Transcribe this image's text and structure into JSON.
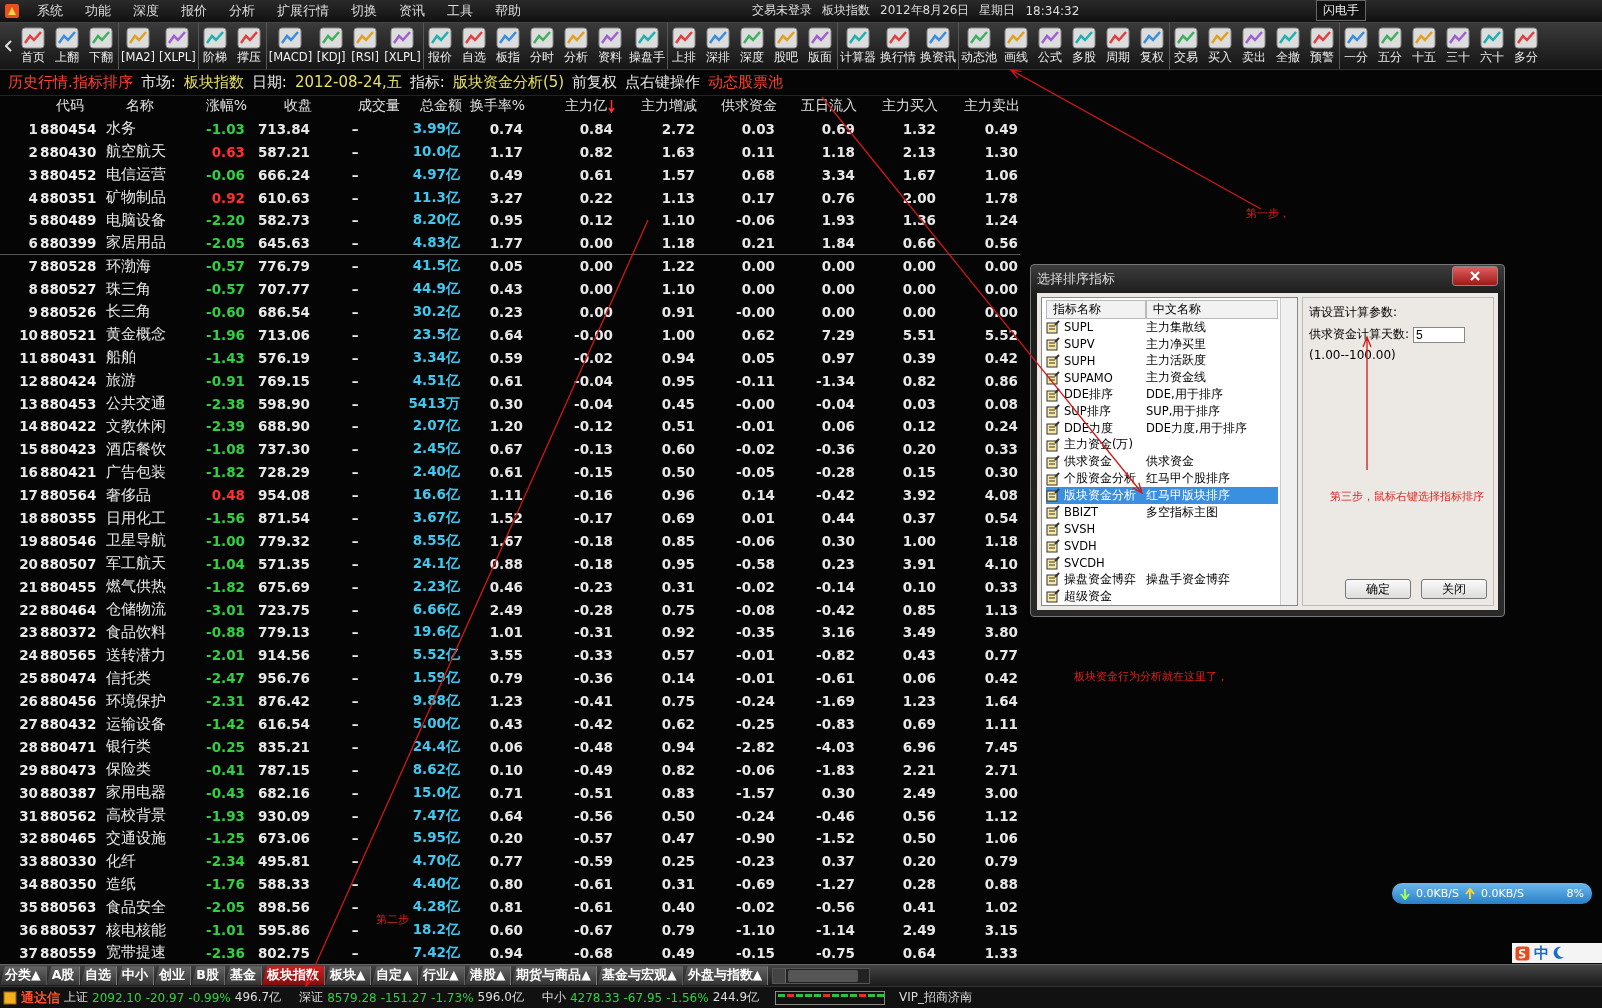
{
  "menu_bar": {
    "items": [
      "系统",
      "功能",
      "深度",
      "报价",
      "分析",
      "扩展行情",
      "切换",
      "资讯",
      "工具",
      "帮助"
    ],
    "status": [
      "交易未登录",
      "板块指数",
      "2012年8月26日",
      "星期日",
      "18:34:32"
    ],
    "flash_button": "闪电手"
  },
  "toolbar": {
    "items": [
      {
        "label": "首页"
      },
      {
        "label": "上翻"
      },
      {
        "label": "下翻"
      },
      {
        "label": "[MA2]",
        "sep_before": true
      },
      {
        "label": "[XLPL]"
      },
      {
        "label": "阶梯",
        "sep_before": true
      },
      {
        "label": "撑压"
      },
      {
        "label": "[MACD]",
        "sep_before": true
      },
      {
        "label": "[KDJ]"
      },
      {
        "label": "[RSI]"
      },
      {
        "label": "[XLPL]"
      },
      {
        "label": "报价",
        "sep_before": true
      },
      {
        "label": "自选"
      },
      {
        "label": "板指"
      },
      {
        "label": "分时"
      },
      {
        "label": "分析"
      },
      {
        "label": "资料"
      },
      {
        "label": "操盘手"
      },
      {
        "label": "上排",
        "sep_before": true
      },
      {
        "label": "深排"
      },
      {
        "label": "深度"
      },
      {
        "label": "股吧"
      },
      {
        "label": "版面"
      },
      {
        "label": "计算器",
        "sep_before": true
      },
      {
        "label": "换行情"
      },
      {
        "label": "换资讯"
      },
      {
        "label": "动态池",
        "sep_before": true
      },
      {
        "label": "画线"
      },
      {
        "label": "公式"
      },
      {
        "label": "多股"
      },
      {
        "label": "周期"
      },
      {
        "label": "复权"
      },
      {
        "label": "交易",
        "sep_before": true
      },
      {
        "label": "买入"
      },
      {
        "label": "卖出"
      },
      {
        "label": "全撤"
      },
      {
        "label": "预警"
      },
      {
        "label": "一分",
        "sep_before": true
      },
      {
        "label": "五分"
      },
      {
        "label": "十五"
      },
      {
        "label": "三十"
      },
      {
        "label": "六十"
      },
      {
        "label": "多分"
      }
    ]
  },
  "info_line": [
    {
      "text": "历史行情.指标排序",
      "color": "#ff4030"
    },
    {
      "text": "市场:",
      "color": "#e8e8e8"
    },
    {
      "text": "板块指数",
      "color": "#e8e060"
    },
    {
      "text": "日期:",
      "color": "#e8e8e8"
    },
    {
      "text": "2012-08-24,五",
      "color": "#e8e060"
    },
    {
      "text": "指标:",
      "color": "#e8e8e8"
    },
    {
      "text": "版块资金分析(5)",
      "color": "#e8e060"
    },
    {
      "text": "前复权",
      "color": "#e8e8e8"
    },
    {
      "text": "点右键操作",
      "color": "#e8e8e8"
    },
    {
      "text": "动态股票池",
      "color": "#ff4030"
    }
  ],
  "table": {
    "columns": [
      {
        "label": "代码",
        "sorted": false
      },
      {
        "label": "名称",
        "sorted": false
      },
      {
        "label": "涨幅%",
        "sorted": false
      },
      {
        "label": "收盘",
        "sorted": false
      },
      {
        "label": "成交量",
        "sorted": false
      },
      {
        "label": "总金额",
        "sorted": false
      },
      {
        "label": "换手率%",
        "sorted": false
      },
      {
        "label": "主力亿",
        "sorted": true
      },
      {
        "label": "主力增减",
        "sorted": false
      },
      {
        "label": "供求资金",
        "sorted": false
      },
      {
        "label": "五日流入",
        "sorted": false
      },
      {
        "label": "主力买入",
        "sorted": false
      },
      {
        "label": "主力卖出",
        "sorted": false
      }
    ],
    "rows": [
      {
        "no": "1",
        "rising": false,
        "cells": [
          "880454",
          "水务",
          "-1.03",
          "713.84",
          "–",
          "3.99亿",
          "0.74",
          "0.84",
          "2.72",
          "0.03",
          "0.69",
          "1.32",
          "0.49"
        ]
      },
      {
        "no": "2",
        "rising": true,
        "cells": [
          "880430",
          "航空航天",
          "0.63",
          "587.21",
          "–",
          "10.0亿",
          "1.17",
          "0.82",
          "1.63",
          "0.11",
          "1.18",
          "2.13",
          "1.30"
        ]
      },
      {
        "no": "3",
        "rising": false,
        "cells": [
          "880452",
          "电信运营",
          "-0.06",
          "666.24",
          "–",
          "4.97亿",
          "0.49",
          "0.61",
          "1.57",
          "0.68",
          "3.34",
          "1.67",
          "1.06"
        ]
      },
      {
        "no": "4",
        "rising": true,
        "cells": [
          "880351",
          "矿物制品",
          "0.92",
          "610.63",
          "–",
          "11.3亿",
          "3.27",
          "0.22",
          "1.13",
          "0.17",
          "0.76",
          "2.00",
          "1.78"
        ]
      },
      {
        "no": "5",
        "rising": false,
        "cells": [
          "880489",
          "电脑设备",
          "-2.20",
          "582.73",
          "–",
          "8.20亿",
          "0.95",
          "0.12",
          "1.10",
          "-0.06",
          "1.93",
          "1.36",
          "1.24"
        ]
      },
      {
        "no": "6",
        "rising": false,
        "divider_after": true,
        "cells": [
          "880399",
          "家居用品",
          "-2.05",
          "645.63",
          "–",
          "4.83亿",
          "1.77",
          "0.00",
          "1.18",
          "0.21",
          "1.84",
          "0.66",
          "0.56"
        ]
      },
      {
        "no": "7",
        "rising": false,
        "cells": [
          "880528",
          "环渤海",
          "-0.57",
          "776.79",
          "–",
          "41.5亿",
          "0.05",
          "0.00",
          "1.22",
          "0.00",
          "0.00",
          "0.00",
          "0.00"
        ]
      },
      {
        "no": "8",
        "rising": false,
        "cells": [
          "880527",
          "珠三角",
          "-0.57",
          "707.77",
          "–",
          "44.9亿",
          "0.43",
          "0.00",
          "1.10",
          "0.00",
          "0.00",
          "0.00",
          "0.00"
        ]
      },
      {
        "no": "9",
        "rising": false,
        "cells": [
          "880526",
          "长三角",
          "-0.60",
          "686.54",
          "–",
          "30.2亿",
          "0.23",
          "0.00",
          "0.91",
          "-0.00",
          "0.00",
          "0.00",
          "0.00"
        ]
      },
      {
        "no": "10",
        "rising": false,
        "cells": [
          "880521",
          "黄金概念",
          "-1.96",
          "713.06",
          "–",
          "23.5亿",
          "0.64",
          "-0.00",
          "1.00",
          "0.62",
          "7.29",
          "5.51",
          "5.52"
        ]
      },
      {
        "no": "11",
        "rising": false,
        "cells": [
          "880431",
          "船舶",
          "-1.43",
          "576.19",
          "–",
          "3.34亿",
          "0.59",
          "-0.02",
          "0.94",
          "0.05",
          "0.97",
          "0.39",
          "0.42"
        ]
      },
      {
        "no": "12",
        "rising": false,
        "cells": [
          "880424",
          "旅游",
          "-0.91",
          "769.15",
          "–",
          "4.51亿",
          "0.61",
          "-0.04",
          "0.95",
          "-0.11",
          "-1.34",
          "0.82",
          "0.86"
        ]
      },
      {
        "no": "13",
        "rising": false,
        "cells": [
          "880453",
          "公共交通",
          "-2.38",
          "598.90",
          "–",
          "5413万",
          "0.30",
          "-0.04",
          "0.45",
          "-0.00",
          "-0.04",
          "0.03",
          "0.08"
        ]
      },
      {
        "no": "14",
        "rising": false,
        "cells": [
          "880422",
          "文教休闲",
          "-2.39",
          "688.90",
          "–",
          "2.07亿",
          "1.20",
          "-0.12",
          "0.51",
          "-0.01",
          "0.06",
          "0.12",
          "0.24"
        ]
      },
      {
        "no": "15",
        "rising": false,
        "cells": [
          "880423",
          "酒店餐饮",
          "-1.08",
          "737.30",
          "–",
          "2.45亿",
          "0.67",
          "-0.13",
          "0.60",
          "-0.02",
          "-0.36",
          "0.20",
          "0.33"
        ]
      },
      {
        "no": "16",
        "rising": false,
        "cells": [
          "880421",
          "广告包装",
          "-1.82",
          "728.29",
          "–",
          "2.40亿",
          "0.61",
          "-0.15",
          "0.50",
          "-0.05",
          "-0.28",
          "0.15",
          "0.30"
        ]
      },
      {
        "no": "17",
        "rising": true,
        "cells": [
          "880564",
          "奢侈品",
          "0.48",
          "954.08",
          "–",
          "16.6亿",
          "1.11",
          "-0.16",
          "0.96",
          "0.14",
          "-0.42",
          "3.92",
          "4.08"
        ]
      },
      {
        "no": "18",
        "rising": false,
        "cells": [
          "880355",
          "日用化工",
          "-1.56",
          "871.54",
          "–",
          "3.67亿",
          "1.52",
          "-0.17",
          "0.69",
          "0.01",
          "0.44",
          "0.37",
          "0.54"
        ]
      },
      {
        "no": "19",
        "rising": false,
        "cells": [
          "880546",
          "卫星导航",
          "-1.00",
          "779.32",
          "–",
          "8.55亿",
          "1.67",
          "-0.18",
          "0.85",
          "-0.06",
          "0.30",
          "1.00",
          "1.18"
        ]
      },
      {
        "no": "20",
        "rising": false,
        "cells": [
          "880507",
          "军工航天",
          "-1.04",
          "571.35",
          "–",
          "24.1亿",
          "0.88",
          "-0.18",
          "0.95",
          "-0.58",
          "0.23",
          "3.91",
          "4.10"
        ]
      },
      {
        "no": "21",
        "rising": false,
        "cells": [
          "880455",
          "燃气供热",
          "-1.82",
          "675.69",
          "–",
          "2.23亿",
          "0.46",
          "-0.23",
          "0.31",
          "-0.02",
          "-0.14",
          "0.10",
          "0.33"
        ]
      },
      {
        "no": "22",
        "rising": false,
        "cells": [
          "880464",
          "仓储物流",
          "-3.01",
          "723.75",
          "–",
          "6.66亿",
          "2.49",
          "-0.28",
          "0.75",
          "-0.08",
          "-0.42",
          "0.85",
          "1.13"
        ]
      },
      {
        "no": "23",
        "rising": false,
        "cells": [
          "880372",
          "食品饮料",
          "-0.88",
          "779.13",
          "–",
          "19.6亿",
          "1.01",
          "-0.31",
          "0.92",
          "-0.35",
          "3.16",
          "3.49",
          "3.80"
        ]
      },
      {
        "no": "24",
        "rising": false,
        "cells": [
          "880565",
          "送转潜力",
          "-2.01",
          "914.56",
          "–",
          "5.52亿",
          "3.55",
          "-0.33",
          "0.57",
          "-0.01",
          "-0.82",
          "0.43",
          "0.77"
        ]
      },
      {
        "no": "25",
        "rising": false,
        "cells": [
          "880474",
          "信托类",
          "-2.47",
          "956.76",
          "–",
          "1.59亿",
          "0.79",
          "-0.36",
          "0.14",
          "-0.01",
          "-0.61",
          "0.06",
          "0.42"
        ]
      },
      {
        "no": "26",
        "rising": false,
        "cells": [
          "880456",
          "环境保护",
          "-2.31",
          "876.42",
          "–",
          "9.88亿",
          "1.23",
          "-0.41",
          "0.75",
          "-0.24",
          "-1.69",
          "1.23",
          "1.64"
        ]
      },
      {
        "no": "27",
        "rising": false,
        "cells": [
          "880432",
          "运输设备",
          "-1.42",
          "616.54",
          "–",
          "5.00亿",
          "0.43",
          "-0.42",
          "0.62",
          "-0.25",
          "-0.83",
          "0.69",
          "1.11"
        ]
      },
      {
        "no": "28",
        "rising": false,
        "cells": [
          "880471",
          "银行类",
          "-0.25",
          "835.21",
          "–",
          "24.4亿",
          "0.06",
          "-0.48",
          "0.94",
          "-2.82",
          "-4.03",
          "6.96",
          "7.45"
        ]
      },
      {
        "no": "29",
        "rising": false,
        "cells": [
          "880473",
          "保险类",
          "-0.41",
          "787.15",
          "–",
          "8.62亿",
          "0.10",
          "-0.49",
          "0.82",
          "-0.06",
          "-1.83",
          "2.21",
          "2.71"
        ]
      },
      {
        "no": "30",
        "rising": false,
        "cells": [
          "880387",
          "家用电器",
          "-0.43",
          "682.16",
          "–",
          "15.0亿",
          "0.71",
          "-0.51",
          "0.83",
          "-1.57",
          "0.30",
          "2.49",
          "3.00"
        ]
      },
      {
        "no": "31",
        "rising": false,
        "cells": [
          "880562",
          "高校背景",
          "-1.93",
          "930.09",
          "–",
          "7.47亿",
          "0.64",
          "-0.56",
          "0.50",
          "-0.24",
          "-0.46",
          "0.56",
          "1.12"
        ]
      },
      {
        "no": "32",
        "rising": false,
        "cells": [
          "880465",
          "交通设施",
          "-1.25",
          "673.06",
          "–",
          "5.95亿",
          "0.20",
          "-0.57",
          "0.47",
          "-0.90",
          "-1.52",
          "0.50",
          "1.06"
        ]
      },
      {
        "no": "33",
        "rising": false,
        "cells": [
          "880330",
          "化纤",
          "-2.34",
          "495.81",
          "–",
          "4.70亿",
          "0.77",
          "-0.59",
          "0.25",
          "-0.23",
          "0.37",
          "0.20",
          "0.79"
        ]
      },
      {
        "no": "34",
        "rising": false,
        "cells": [
          "880350",
          "造纸",
          "-1.76",
          "588.33",
          "–",
          "4.40亿",
          "0.80",
          "-0.61",
          "0.31",
          "-0.69",
          "-1.27",
          "0.28",
          "0.88"
        ]
      },
      {
        "no": "35",
        "rising": false,
        "cells": [
          "880563",
          "食品安全",
          "-2.05",
          "898.56",
          "–",
          "4.28亿",
          "0.81",
          "-0.61",
          "0.40",
          "-0.02",
          "-0.56",
          "0.41",
          "1.02"
        ]
      },
      {
        "no": "36",
        "rising": false,
        "cells": [
          "880537",
          "核电核能",
          "-1.01",
          "595.86",
          "–",
          "18.2亿",
          "0.60",
          "-0.67",
          "0.79",
          "-1.10",
          "-1.14",
          "2.49",
          "3.15"
        ]
      },
      {
        "no": "37",
        "rising": false,
        "cells": [
          "880559",
          "宽带提速",
          "-2.36",
          "802.75",
          "–",
          "7.42亿",
          "0.94",
          "-0.68",
          "0.49",
          "-0.15",
          "-0.75",
          "0.64",
          "1.33"
        ]
      }
    ]
  },
  "bottom_tabs": [
    {
      "label": "分类▲",
      "selected": false
    },
    {
      "label": "A股",
      "selected": false
    },
    {
      "label": "自选",
      "selected": false
    },
    {
      "label": "中小",
      "selected": false
    },
    {
      "label": "创业",
      "selected": false
    },
    {
      "label": "B股",
      "selected": false
    },
    {
      "label": "基金",
      "selected": false
    },
    {
      "label": "板块指数",
      "selected": true
    },
    {
      "label": "板块▲",
      "selected": false
    },
    {
      "label": "自定▲",
      "selected": false
    },
    {
      "label": "行业▲",
      "selected": false
    },
    {
      "label": "港股▲",
      "selected": false
    },
    {
      "label": "期货与商品▲",
      "selected": false
    },
    {
      "label": "基金与宏观▲",
      "selected": false
    },
    {
      "label": "外盘与指数▲",
      "selected": false
    }
  ],
  "status_bar": {
    "brand": "通达信",
    "indices": [
      {
        "name": "上证",
        "value": "2092.10",
        "change": "-20.97",
        "pct": "-0.99%",
        "amount": "496.7亿",
        "rising": false
      },
      {
        "name": "深证",
        "value": "8579.28",
        "change": "-151.27",
        "pct": "-1.73%",
        "amount": "596.0亿",
        "rising": false
      },
      {
        "name": "中小",
        "value": "4278.33",
        "change": "-67.95",
        "pct": "-1.56%",
        "amount": "244.9亿",
        "rising": false
      }
    ],
    "server": "VIP_招商济南"
  },
  "network": {
    "down": "0.0KB/S",
    "up": "0.0KB/S",
    "load": "8%"
  },
  "ime": {
    "mode": "中"
  },
  "dialog": {
    "title": "选择排序指标",
    "columns": [
      "指标名称",
      "中文名称"
    ],
    "items": [
      {
        "name": "SUPL",
        "cn": "主力集散线",
        "selected": false
      },
      {
        "name": "SUPV",
        "cn": "主力净买里",
        "selected": false
      },
      {
        "name": "SUPH",
        "cn": "主力活跃度",
        "selected": false
      },
      {
        "name": "SUPAMO",
        "cn": "主力资金线",
        "selected": false
      },
      {
        "name": "DDE排序",
        "cn": "DDE,用于排序",
        "selected": false
      },
      {
        "name": "SUP排序",
        "cn": "SUP,用于排序",
        "selected": false
      },
      {
        "name": "DDE力度",
        "cn": "DDE力度,用于排序",
        "selected": false
      },
      {
        "name": "主力资金(万)",
        "selected": false
      },
      {
        "name": "供求资金",
        "cn": "供求资金",
        "selected": false
      },
      {
        "name": "个股资金分析",
        "cn": "红马甲个股排序",
        "selected": false
      },
      {
        "name": "版块资金分析",
        "cn": "红马甲版块排序",
        "selected": true
      },
      {
        "name": "BBIZT",
        "cn": "多空指标主图",
        "selected": false
      },
      {
        "name": "SVSH",
        "selected": false
      },
      {
        "name": "SVDH",
        "selected": false
      },
      {
        "name": "SVCDH",
        "selected": false
      },
      {
        "name": "操盘资金博弈",
        "cn": "操盘手资金博弈",
        "selected": false
      },
      {
        "name": "超级资金",
        "selected": false
      }
    ],
    "param_title": "请设置计算参数:",
    "param_label": "供求资金计算天数:",
    "param_value": "5",
    "param_range": "(1.00--100.00)",
    "buttons": [
      "确定",
      "关闭"
    ]
  },
  "annotations": [
    {
      "text": "第一步，"
    },
    {
      "text": "第二步"
    },
    {
      "text": "第三步，鼠标右键选择指标排序"
    },
    {
      "text": "板块资金行为分析就在这里了，"
    }
  ]
}
